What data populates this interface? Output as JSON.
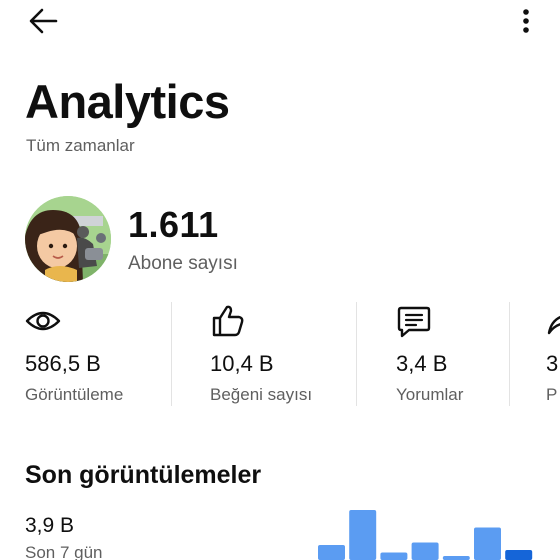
{
  "header": {
    "back_icon": "arrow-left-icon",
    "more_icon": "more-vert-icon"
  },
  "page": {
    "title": "Analytics",
    "subtitle": "Tüm zamanlar"
  },
  "channel": {
    "subscriber_count": "1.611",
    "subscriber_label": "Abone sayısı"
  },
  "stats": [
    {
      "icon": "eye-icon",
      "value": "586,5 B",
      "label": "Görüntüleme"
    },
    {
      "icon": "thumb-up-icon",
      "value": "10,4 B",
      "label": "Beğeni sayısı"
    },
    {
      "icon": "comment-icon",
      "value": "3,4 B",
      "label": "Yorumlar"
    },
    {
      "icon": "share-icon",
      "value": "3",
      "label": "P"
    }
  ],
  "recent": {
    "title": "Son görüntülemeler",
    "value": "3,9 B",
    "period": "Son 7 gün"
  },
  "chart_data": {
    "type": "bar",
    "values": [
      0.3,
      1.0,
      0.15,
      0.35,
      0.05,
      0.65,
      0.2
    ],
    "colors": {
      "bar": "#5b9cf2",
      "highlight": "#1565d8"
    }
  }
}
